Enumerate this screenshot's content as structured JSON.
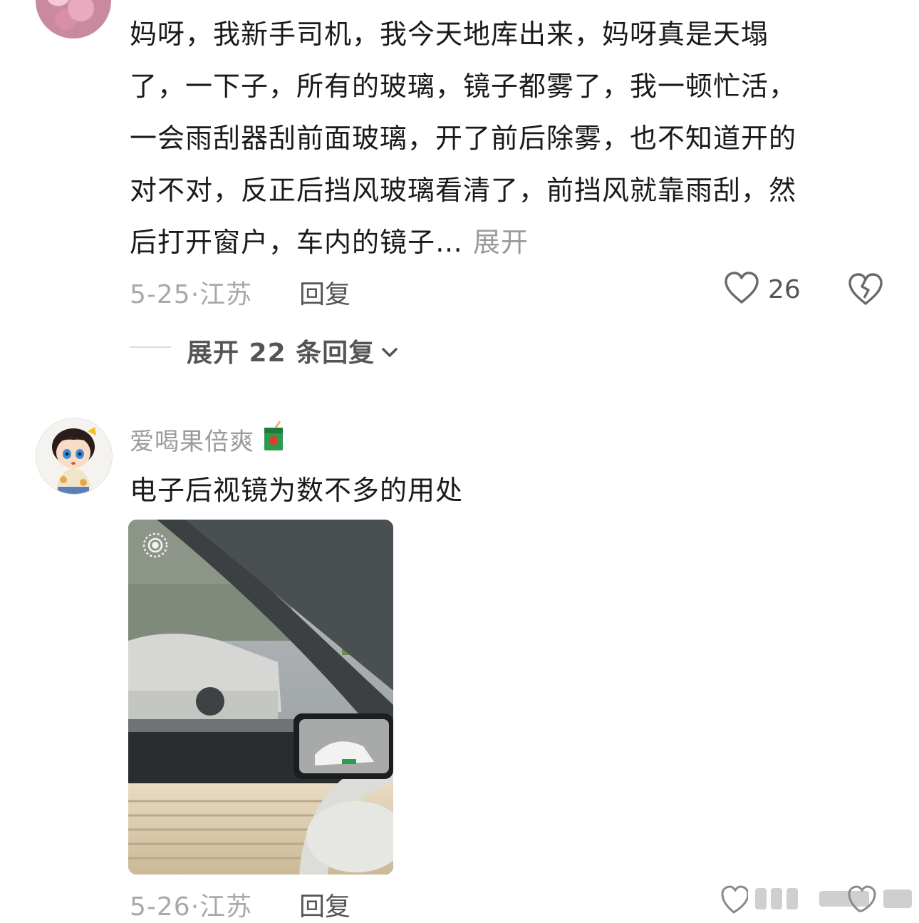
{
  "comment1": {
    "lines": [
      "妈呀，我新手司机，我今天地库出来，妈呀真是天塌",
      "了，一下子，所有的玻璃，镜子都雾了，我一顿忙活，",
      "一会雨刮器刮前面玻璃，开了前后除雾，也不知道开的",
      "对不对，反正后挡风玻璃看清了，前挡风就靠雨刮，然",
      "后打开窗户，车内的镜子…"
    ],
    "expand_label": "展开",
    "date": "5-25",
    "location": "江苏",
    "reply_label": "回复",
    "like_count": "26",
    "expand_replies_label": "展开 22 条回复"
  },
  "comment2": {
    "username": "爱喝果倍爽",
    "text": "电子后视镜为数不多的用处",
    "date": "5-26",
    "location": "江苏",
    "reply_label": "回复"
  },
  "icons": {
    "like": "heart-outline-icon",
    "dislike": "broken-heart-icon",
    "expand": "chevron-down-icon",
    "badge": "juice-box-icon",
    "live": "live-photo-icon"
  }
}
